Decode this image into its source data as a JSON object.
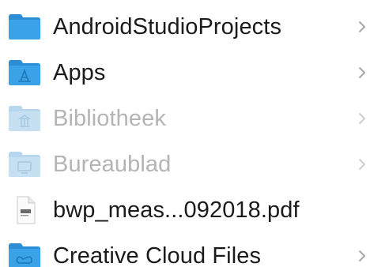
{
  "file_list": {
    "items": [
      {
        "label": "AndroidStudioProjects",
        "icon": "folder-icon",
        "dimmed": false,
        "has_disclosure": true
      },
      {
        "label": "Apps",
        "icon": "applications-folder-icon",
        "dimmed": false,
        "has_disclosure": true
      },
      {
        "label": "Bibliotheek",
        "icon": "library-folder-icon",
        "dimmed": true,
        "has_disclosure": true
      },
      {
        "label": "Bureaublad",
        "icon": "desktop-folder-icon",
        "dimmed": true,
        "has_disclosure": true
      },
      {
        "label": "bwp_meas...092018.pdf",
        "icon": "pdf-document-icon",
        "dimmed": false,
        "has_disclosure": false
      },
      {
        "label": "Creative Cloud Files",
        "icon": "creative-cloud-folder-icon",
        "dimmed": false,
        "has_disclosure": true
      }
    ]
  },
  "colors": {
    "folder_blue": "#3aa2e6",
    "folder_blue_dark": "#2b8ed4",
    "folder_dimmed": "#c6e0f2",
    "text": "#1b1b1b",
    "text_dimmed": "#b4b4b4",
    "chevron": "#a8a8a8"
  }
}
